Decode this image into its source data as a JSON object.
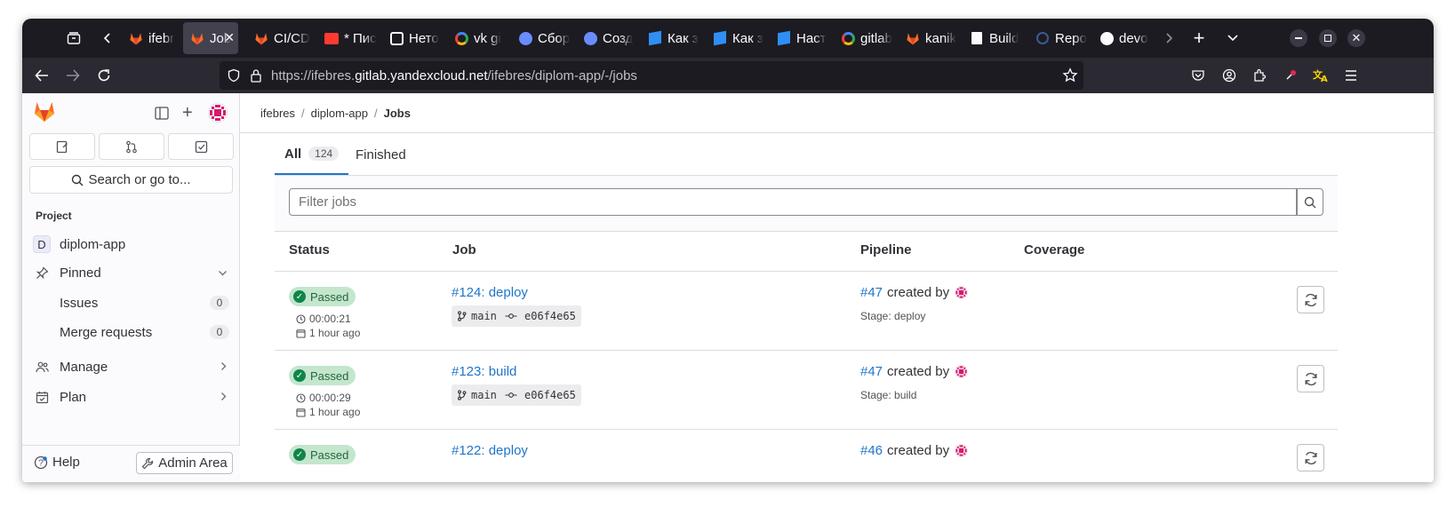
{
  "browser": {
    "tabs": [
      {
        "label": "ifebr",
        "icon": "gitlab-icon"
      },
      {
        "label": "Jobs",
        "icon": "gitlab-icon",
        "active": true
      },
      {
        "label": "CI/CD",
        "icon": "gitlab-icon"
      },
      {
        "label": "* Пис",
        "icon": "mail-icon"
      },
      {
        "label": "Нето",
        "icon": "netology-icon"
      },
      {
        "label": "vk gi",
        "icon": "google-icon"
      },
      {
        "label": "Сбор",
        "icon": "compass-icon"
      },
      {
        "label": "Созд",
        "icon": "compass-icon"
      },
      {
        "label": "Как з",
        "icon": "cube-icon"
      },
      {
        "label": "Как з",
        "icon": "cube-icon"
      },
      {
        "label": "Наст",
        "icon": "cube-icon"
      },
      {
        "label": "gitlab",
        "icon": "google-icon"
      },
      {
        "label": "kanik",
        "icon": "gitlab-icon"
      },
      {
        "label": "Build",
        "icon": "book-icon"
      },
      {
        "label": "Repo",
        "icon": "circle-icon"
      },
      {
        "label": "devo",
        "icon": "github-icon"
      }
    ],
    "url_prefix": "https://ifebres.",
    "url_host": "gitlab.yandexcloud.net",
    "url_path": "/ifebres/diplom-app/-/jobs"
  },
  "sidebar": {
    "search_label": "Search or go to...",
    "section_title": "Project",
    "project_initial": "D",
    "project_name": "diplom-app",
    "pinned_label": "Pinned",
    "issues_label": "Issues",
    "issues_count": "0",
    "mr_label": "Merge requests",
    "mr_count": "0",
    "manage_label": "Manage",
    "plan_label": "Plan",
    "help_label": "Help",
    "admin_label": "Admin Area"
  },
  "breadcrumb": {
    "owner": "ifebres",
    "project": "diplom-app",
    "page": "Jobs"
  },
  "tabs": {
    "all_label": "All",
    "all_count": "124",
    "finished_label": "Finished"
  },
  "filter": {
    "placeholder": "Filter jobs"
  },
  "table": {
    "headers": {
      "status": "Status",
      "job": "Job",
      "pipeline": "Pipeline",
      "coverage": "Coverage"
    },
    "rows": [
      {
        "status": "Passed",
        "duration": "00:00:21",
        "finished": "1 hour ago",
        "job": "#124: deploy",
        "branch": "main",
        "commit": "e06f4e65",
        "pipeline": "#47",
        "created_by": "created by",
        "stage": "Stage: deploy"
      },
      {
        "status": "Passed",
        "duration": "00:00:29",
        "finished": "1 hour ago",
        "job": "#123: build",
        "branch": "main",
        "commit": "e06f4e65",
        "pipeline": "#47",
        "created_by": "created by",
        "stage": "Stage: build"
      },
      {
        "status": "Passed",
        "job": "#122: deploy",
        "pipeline": "#46",
        "created_by": "created by"
      }
    ]
  },
  "colors": {
    "link": "#1f75cb",
    "success": "#108548",
    "success_bg": "#c3e6cd",
    "gitlab_orange": "#fc6d26"
  }
}
